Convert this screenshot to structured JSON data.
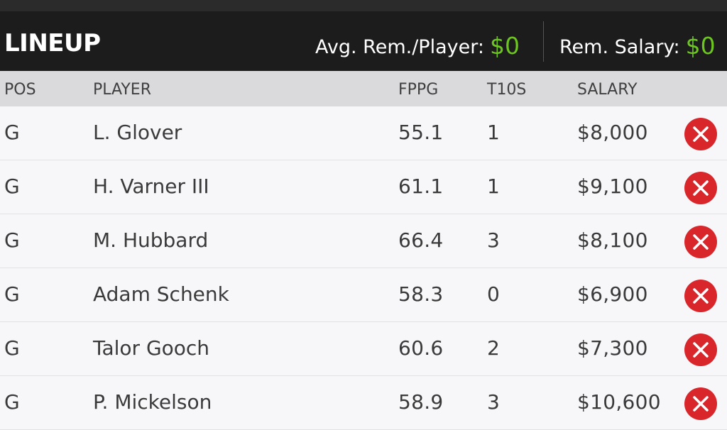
{
  "header": {
    "title": "LINEUP",
    "avg_label": "Avg. Rem./Player:",
    "avg_value": "$0",
    "rem_label": "Rem. Salary:",
    "rem_value": "$0"
  },
  "columns": {
    "pos": "POS",
    "player": "PLAYER",
    "fppg": "FPPG",
    "t10s": "T10S",
    "salary": "SALARY"
  },
  "rows": [
    {
      "pos": "G",
      "player": "L. Glover",
      "fppg": "55.1",
      "t10s": "1",
      "salary": "$8,000"
    },
    {
      "pos": "G",
      "player": "H. Varner III",
      "fppg": "61.1",
      "t10s": "1",
      "salary": "$9,100"
    },
    {
      "pos": "G",
      "player": "M. Hubbard",
      "fppg": "66.4",
      "t10s": "3",
      "salary": "$8,100"
    },
    {
      "pos": "G",
      "player": "Adam Schenk",
      "fppg": "58.3",
      "t10s": "0",
      "salary": "$6,900"
    },
    {
      "pos": "G",
      "player": "Talor Gooch",
      "fppg": "60.6",
      "t10s": "2",
      "salary": "$7,300"
    },
    {
      "pos": "G",
      "player": "P. Mickelson",
      "fppg": "58.9",
      "t10s": "3",
      "salary": "$10,600"
    }
  ],
  "colors": {
    "header_bg": "#1c1c1c",
    "money_green": "#6cc521",
    "remove_red": "#d8262b",
    "colhead_bg": "#dadadc",
    "row_bg": "#f7f7f9"
  },
  "icons": {
    "remove": "close-circle-icon"
  }
}
